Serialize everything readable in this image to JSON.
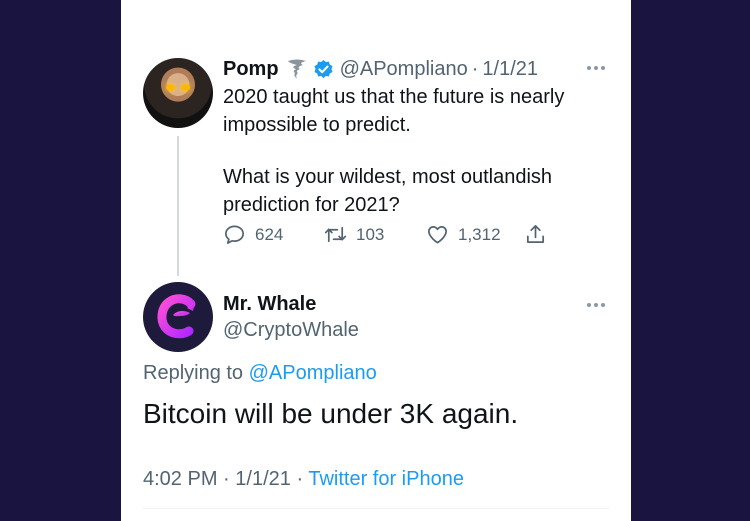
{
  "colors": {
    "background": "#1a1540",
    "card": "#ffffff",
    "text": "#0f1419",
    "secondary": "#536471",
    "link": "#1d9bf0",
    "verified": "#1d9bf0",
    "whale_accent": "#e040fb"
  },
  "original_tweet": {
    "author_name": "Pomp",
    "name_emoji": "tornado-icon",
    "handle": "@APompliano",
    "separator": "·",
    "date": "1/1/21",
    "text_line1": "2020 taught us that the future is nearly impossible to predict.",
    "text_line2": "What is your wildest, most outlandish prediction for 2021?",
    "reply_count": "624",
    "retweet_count": "103",
    "like_count": "1,312"
  },
  "reply_tweet": {
    "author_name": "Mr. Whale",
    "handle": "@CryptoWhale",
    "replying_prefix": "Replying to",
    "replying_mention": "@APompliano",
    "text": "Bitcoin will be under 3K again.",
    "time": "4:02 PM",
    "separator": "·",
    "date": "1/1/21",
    "source": "Twitter for iPhone"
  }
}
